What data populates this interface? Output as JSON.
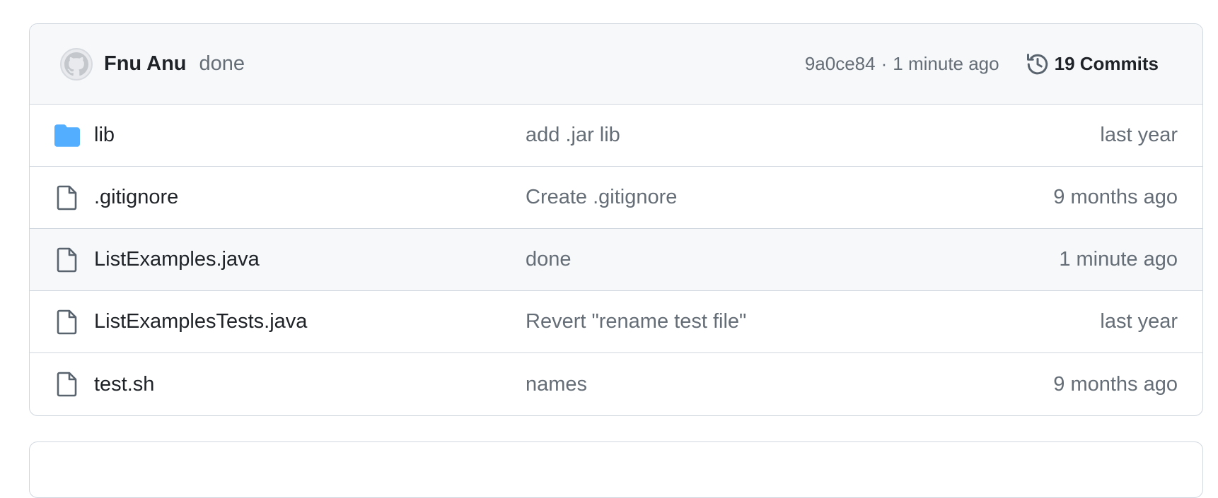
{
  "commit": {
    "author": "Fnu Anu",
    "message": "done",
    "sha": "9a0ce84",
    "separator": "·",
    "time": "1 minute ago",
    "commits_label": "19 Commits",
    "avatar_icon": "github-octocat-avatar",
    "history_icon": "history-clock-icon"
  },
  "files": [
    {
      "name": "lib",
      "message": "add .jar lib",
      "age": "last year",
      "icon": "folder-icon"
    },
    {
      "name": ".gitignore",
      "message": "Create .gitignore",
      "age": "9 months ago",
      "icon": "file-icon"
    },
    {
      "name": "ListExamples.java",
      "message": "done",
      "age": "1 minute ago",
      "icon": "file-icon"
    },
    {
      "name": "ListExamplesTests.java",
      "message": "Revert \"rename test file\"",
      "age": "last year",
      "icon": "file-icon"
    },
    {
      "name": "test.sh",
      "message": "names",
      "age": "9 months ago",
      "icon": "file-icon"
    }
  ],
  "colors": {
    "folder": "#54aeff",
    "border": "#d0d7de",
    "header_bg": "#f6f8fa",
    "muted_text": "#656d76",
    "primary_text": "#1f2328"
  }
}
